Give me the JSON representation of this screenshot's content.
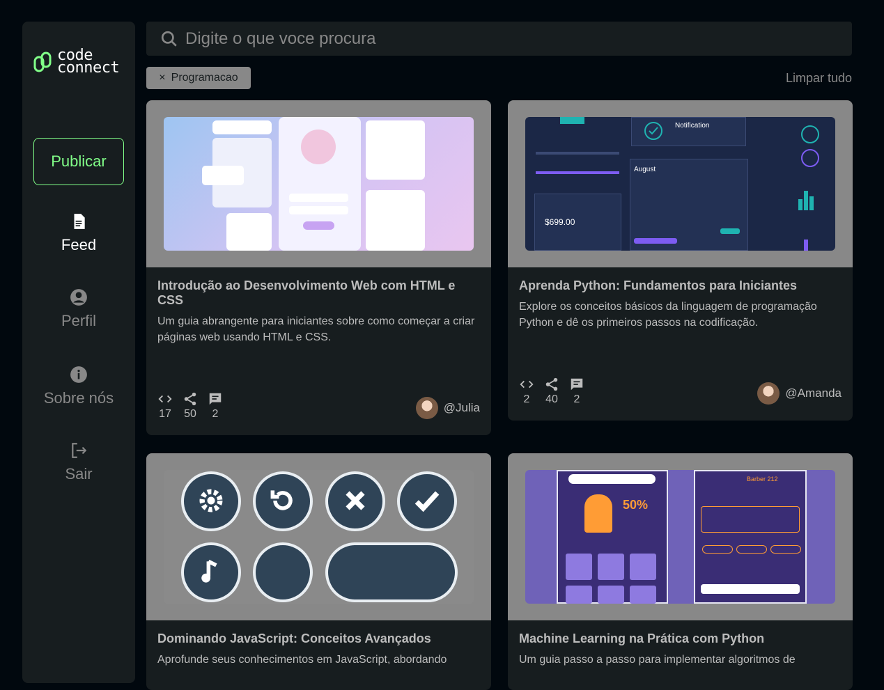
{
  "brand": {
    "line1": "code",
    "line2": "connect",
    "accent": "#81FE88"
  },
  "sidebar": {
    "publish_label": "Publicar",
    "items": [
      {
        "label": "Feed",
        "icon": "document-icon",
        "active": true
      },
      {
        "label": "Perfil",
        "icon": "user-icon",
        "active": false
      },
      {
        "label": "Sobre nós",
        "icon": "info-icon",
        "active": false
      },
      {
        "label": "Sair",
        "icon": "logout-icon",
        "active": false
      }
    ]
  },
  "search": {
    "placeholder": "Digite o que voce procura"
  },
  "filters": {
    "tag": "Programacao",
    "clear_label": "Limpar tudo"
  },
  "cards": [
    {
      "title": "Introdução ao Desenvolvimento Web com HTML e CSS",
      "description": "Um guia abrangente para iniciantes sobre como começar a criar páginas web usando HTML e CSS.",
      "code": "17",
      "shares": "50",
      "comments": "2",
      "author": "@Julia"
    },
    {
      "title": "Aprenda Python: Fundamentos para Iniciantes",
      "description": "Explore os conceitos básicos da linguagem de programação Python e dê os primeiros passos na codificação.",
      "code": "2",
      "shares": "40",
      "comments": "2",
      "author": "@Amanda"
    },
    {
      "title": "Dominando JavaScript: Conceitos Avançados",
      "description": "Aprofunde seus conhecimentos em JavaScript, abordando",
      "code": "",
      "shares": "",
      "comments": "",
      "author": ""
    },
    {
      "title": "Machine Learning na Prática com Python",
      "description": "Um guia passo a passo para implementar algoritmos de",
      "code": "",
      "shares": "",
      "comments": "",
      "author": ""
    }
  ],
  "thumb_text": {
    "notification": "Notification",
    "month": "August",
    "earnings": "$699.00",
    "discount": "50%",
    "barber": "Barber 212"
  }
}
